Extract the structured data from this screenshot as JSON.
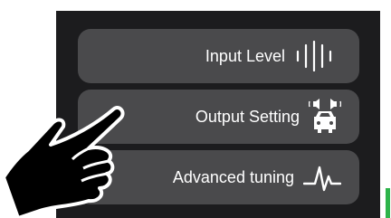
{
  "menu": {
    "items": [
      {
        "label": "Input Level",
        "icon": "waveform-bars-icon"
      },
      {
        "label": "Output Setting",
        "icon": "car-speakers-icon"
      },
      {
        "label": "Advanced tuning",
        "icon": "pulse-line-icon"
      }
    ]
  },
  "overlay": {
    "icon": "pointing-hand-icon"
  },
  "colors": {
    "panel": "#1c1c1e",
    "button": "#4a4a4c",
    "text": "#ffffff",
    "accent": "#2db34a"
  }
}
